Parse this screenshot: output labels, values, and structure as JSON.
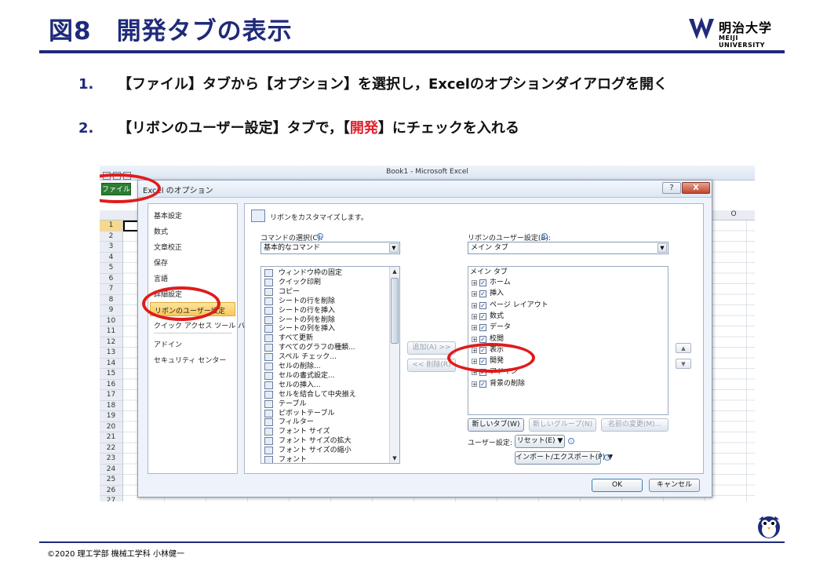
{
  "slide": {
    "title": "図8　開発タブの表示",
    "logo_text": "明治大学",
    "logo_sub": "MEIJI UNIVERSITY",
    "steps": [
      {
        "num": "1.",
        "text": "【ファイル】タブから【オプション】を選択し，Excelのオプションダイアログを開く"
      },
      {
        "num": "2.",
        "pre": "【リボンのユーザー設定】タブで，【",
        "accent": "開発",
        "post": "】にチェックを入れる"
      }
    ],
    "footer": "©2020 理工学部 機械工学科 小林健一",
    "accent_color": "#e0202a",
    "brand_color": "#1f2a7a"
  },
  "excel": {
    "window_title": "Book1 - Microsoft Excel",
    "file_tab": "ファイル",
    "column_o": "O",
    "row_numbers": [
      "1",
      "2",
      "3",
      "4",
      "5",
      "6",
      "7",
      "8",
      "9",
      "10",
      "11",
      "12",
      "13",
      "14",
      "15",
      "16",
      "17",
      "18",
      "19",
      "20",
      "21",
      "22",
      "23",
      "24",
      "25",
      "26",
      "27"
    ]
  },
  "dialog": {
    "title": "Excel のオプション",
    "help": "?",
    "close": "X",
    "nav": [
      "基本設定",
      "数式",
      "文章校正",
      "保存",
      "言語",
      "詳細設定",
      "リボンのユーザー設定",
      "クイック アクセス ツール バー",
      "アドイン",
      "セキュリティ センター"
    ],
    "heading": "リボンをカスタマイズします。",
    "commands_label": "コマンドの選択(C):",
    "commands_value": "基本的なコマンド",
    "ribbon_label": "リボンのユーザー設定(B):",
    "ribbon_value": "メイン タブ",
    "commands": [
      "ウィンドウ枠の固定",
      "クイック印刷",
      "コピー",
      "シートの行を削除",
      "シートの行を挿入",
      "シートの列を削除",
      "シートの列を挿入",
      "すべて更新",
      "すべてのグラフの種類...",
      "スペル チェック...",
      "セルの削除...",
      "セルの書式設定...",
      "セルの挿入...",
      "セルを結合して中央揃え",
      "テーブル",
      "ピボットテーブル",
      "フィルター",
      "フォント サイズ",
      "フォント サイズの拡大",
      "フォント サイズの縮小",
      "フォント"
    ],
    "tree_header": "メイン タブ",
    "tabs": [
      "ホーム",
      "挿入",
      "ページ レイアウト",
      "数式",
      "データ",
      "校閲",
      "表示",
      "開発",
      "アドイン",
      "背景の削除"
    ],
    "add_button": "追加(A) >>",
    "remove_button": "<< 削除(R)",
    "new_tab_button": "新しいタブ(W)",
    "new_group_button": "新しいグループ(N)",
    "rename_button": "名前の変更(M)...",
    "user_setting_label": "ユーザー設定:",
    "reset_button": "リセット(E) ▼",
    "import_export_button": "インポート/エクスポート(P) ▼",
    "ok": "OK",
    "cancel": "キャンセル"
  }
}
